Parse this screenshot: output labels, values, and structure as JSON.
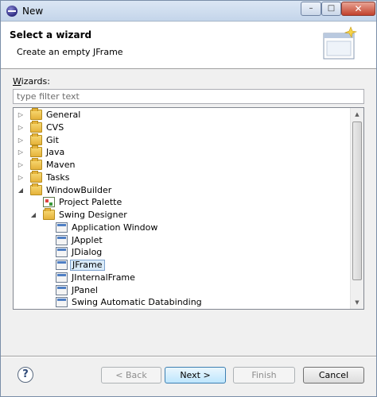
{
  "window": {
    "title": "New",
    "minimize_glyph": "–",
    "maximize_glyph": "□",
    "close_glyph": "✕"
  },
  "header": {
    "title": "Select a wizard",
    "description": "Create an empty JFrame"
  },
  "wizards_label": "Wizards:",
  "filter": {
    "placeholder": "type filter text",
    "value": ""
  },
  "tree": {
    "items": [
      {
        "label": "General",
        "depth": 0,
        "expanded": false,
        "icon": "folder-icon"
      },
      {
        "label": "CVS",
        "depth": 0,
        "expanded": false,
        "icon": "folder-icon"
      },
      {
        "label": "Git",
        "depth": 0,
        "expanded": false,
        "icon": "folder-icon"
      },
      {
        "label": "Java",
        "depth": 0,
        "expanded": false,
        "icon": "folder-icon"
      },
      {
        "label": "Maven",
        "depth": 0,
        "expanded": false,
        "icon": "folder-icon"
      },
      {
        "label": "Tasks",
        "depth": 0,
        "expanded": false,
        "icon": "folder-icon"
      },
      {
        "label": "WindowBuilder",
        "depth": 0,
        "expanded": true,
        "icon": "folder-icon"
      },
      {
        "label": "Project Palette",
        "depth": 1,
        "leaf": true,
        "icon": "palette-icon"
      },
      {
        "label": "Swing Designer",
        "depth": 1,
        "expanded": true,
        "icon": "folder-icon"
      },
      {
        "label": "Application Window",
        "depth": 2,
        "leaf": true,
        "icon": "window-icon"
      },
      {
        "label": "JApplet",
        "depth": 2,
        "leaf": true,
        "icon": "applet-icon"
      },
      {
        "label": "JDialog",
        "depth": 2,
        "leaf": true,
        "icon": "dialog-icon"
      },
      {
        "label": "JFrame",
        "depth": 2,
        "leaf": true,
        "selected": true,
        "icon": "frame-icon"
      },
      {
        "label": "JInternalFrame",
        "depth": 2,
        "leaf": true,
        "icon": "internal-frame-icon"
      },
      {
        "label": "JPanel",
        "depth": 2,
        "leaf": true,
        "icon": "panel-icon"
      },
      {
        "label": "Swing Automatic Databinding",
        "depth": 2,
        "leaf": true,
        "icon": "databinding-icon"
      }
    ]
  },
  "buttons": {
    "help": "?",
    "back": "< Back",
    "next": "Next >",
    "finish": "Finish",
    "cancel": "Cancel"
  },
  "scrollbar": {
    "up": "▲",
    "down": "▼"
  }
}
